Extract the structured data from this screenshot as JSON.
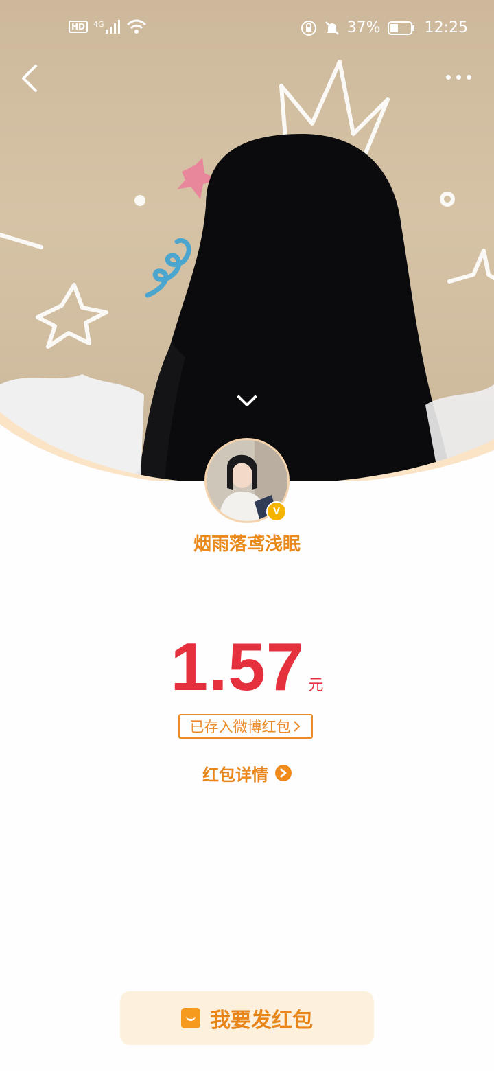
{
  "status_bar": {
    "left_badge": "HD",
    "network": "4G",
    "battery": "37%",
    "time": "12:25",
    "icons": [
      "hd-icon",
      "signal-icon",
      "wifi-icon",
      "rotation-lock-icon",
      "mute-icon",
      "battery-icon"
    ]
  },
  "header": {
    "back_icon": "chevron-left-icon",
    "more_icon": "more-dots-icon",
    "collapse_icon": "chevron-down-icon"
  },
  "sender": {
    "name": "烟雨落鸢浅眠",
    "verified_mark": "V"
  },
  "packet": {
    "amount": "1.57",
    "unit": "元",
    "saved_label": "已存入微博红包",
    "details_label": "红包详情"
  },
  "actions": {
    "send_label": "我要发红包"
  },
  "colors": {
    "amount_red": "#e5303e",
    "accent_orange": "#e8861b",
    "button_bg": "#fdf1de"
  }
}
